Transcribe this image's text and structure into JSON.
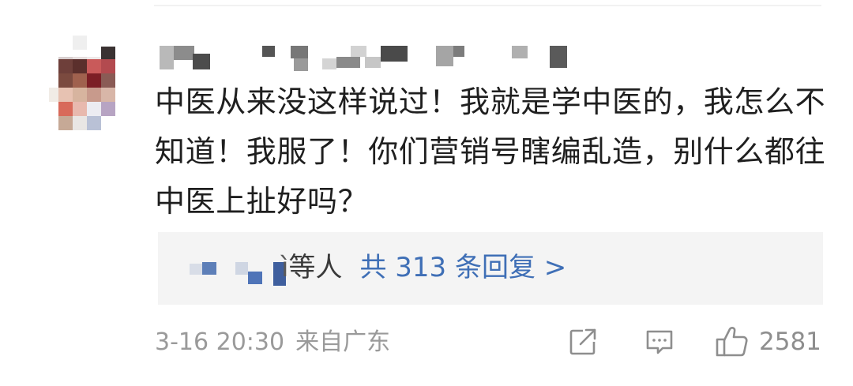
{
  "comment": {
    "text": "中医从来没这样说过！我就是学中医的，我怎么不知道！我服了！你们营销号瞎编乱造，别什么都往中医上扯好吗？"
  },
  "replies": {
    "partial_name": "ì",
    "names_suffix": "等人",
    "count_link": "共 313 条回复 >"
  },
  "footer": {
    "timestamp": "3-16 20:30",
    "location": "来自广东",
    "like_count": "2581"
  },
  "icons": {
    "share": "share-icon",
    "comment": "comment-icon",
    "like": "thumbs-up-icon"
  },
  "colors": {
    "link": "#3f6fb6",
    "text": "#1f1f1f",
    "meta": "#9a9a9a",
    "reply_bg": "#f4f4f4"
  }
}
